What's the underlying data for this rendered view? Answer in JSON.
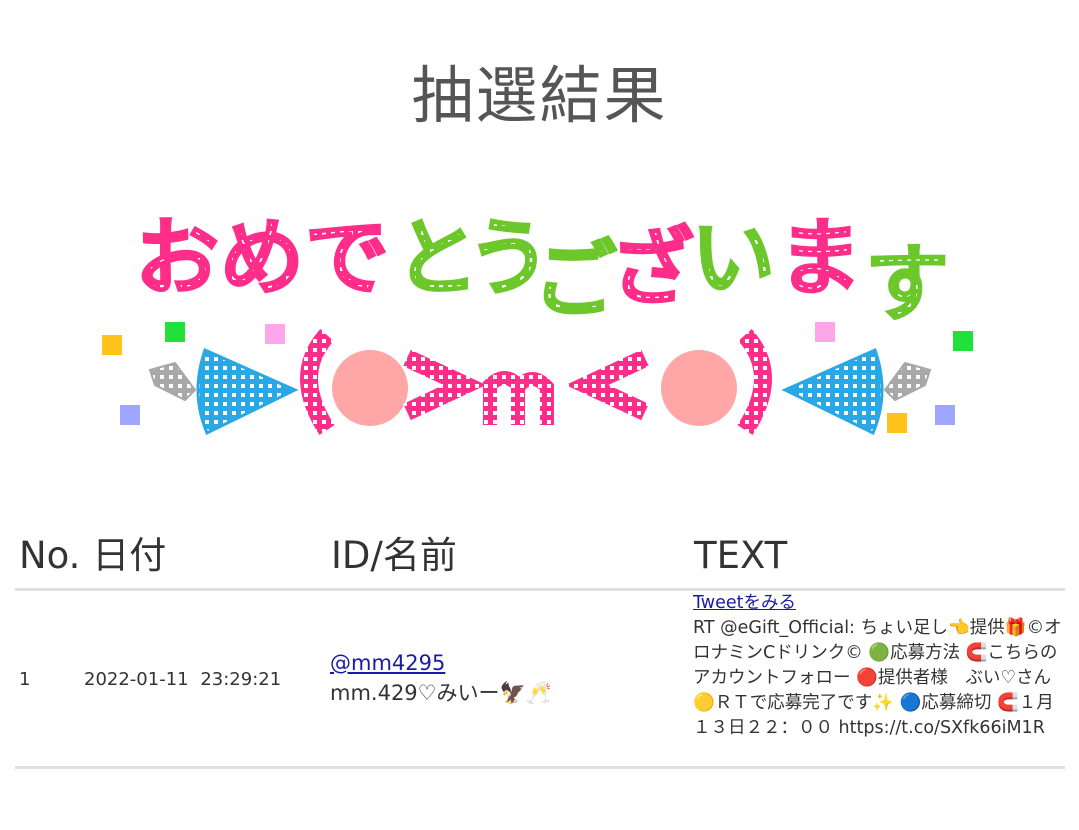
{
  "page": {
    "title": "抽選結果",
    "banner_text": "おめでとうございます",
    "banner_face": "(>m<)"
  },
  "table": {
    "headers": [
      "No.",
      "日付",
      "ID/名前",
      "TEXT"
    ],
    "rows": [
      {
        "no": "1",
        "date": "2022-01-11 23:29:21",
        "handle": "@mm4295",
        "name": "mm.429♡みいー🦅🥂",
        "tweet_link": "Tweetをみる",
        "text": "RT @eGift_Official: ちょい足し👈提供🎁©オロナミンCドリンク© 🟢応募方法 🧲こちらのアカウントフォロー 🔴提供者様　ぶい♡さん 🟡ＲＴで応募完了です✨ 🔵応募締切 🧲１月１３日２２：００ https://t.co/SXfk66iM1R"
      }
    ]
  },
  "colors": {
    "pink": "#ff2d8a",
    "green": "#6cc72a",
    "blue": "#2aa8e6",
    "peach": "#ffa7a7",
    "link": "#1a1aa6"
  }
}
